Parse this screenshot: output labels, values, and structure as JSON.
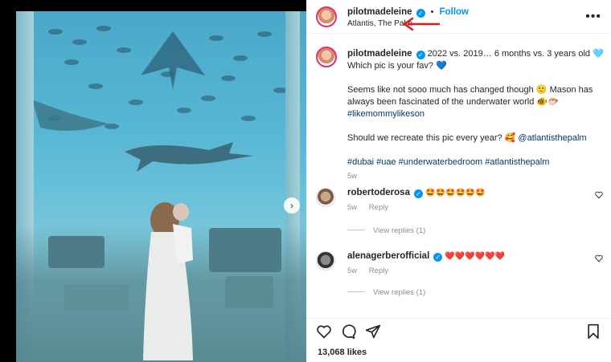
{
  "post": {
    "username": "pilotmadeleine",
    "follow_label": "Follow",
    "separator": "•",
    "location": "Atlantis, The Palm",
    "more_icon": "more-horizontal-icon",
    "verified_icon": "verified-badge-icon"
  },
  "caption": {
    "username": "pilotmadeleine",
    "line1": "2022 vs. 2019… 6 months vs. 3 years old 🩵",
    "line2": "Which pic is your fav? 💙",
    "para2_a": "Seems like not sooo much has changed though 🙂 Mason has always been fascinated of the underwater world 🐠🐡",
    "hashtag1": "#likemommylikeson",
    "para3": "Should we recreate this pic every year? 🥰 ",
    "mention": "@atlantisthepalm",
    "hashtags": [
      "#dubai",
      "#uae",
      "#underwaterbedroom",
      "#atlantisthepalm"
    ],
    "age": "5w"
  },
  "comments": [
    {
      "username": "robertoderosa",
      "text": "🤩🤩🤩🤩🤩🤩",
      "age": "5w",
      "reply_label": "Reply",
      "view_replies": "View replies (1)"
    },
    {
      "username": "alenagerberofficial",
      "text": "❤️❤️❤️❤️❤️❤️",
      "age": "5w",
      "reply_label": "Reply",
      "view_replies": "View replies (1)"
    }
  ],
  "actions": {
    "like_icon": "heart-icon",
    "comment_icon": "comment-icon",
    "share_icon": "share-icon",
    "save_icon": "bookmark-icon"
  },
  "likes_text": "13,068 likes",
  "colors": {
    "accent": "#0095f6",
    "annotation_arrow": "#e0191b",
    "hashtag": "#00376b"
  }
}
